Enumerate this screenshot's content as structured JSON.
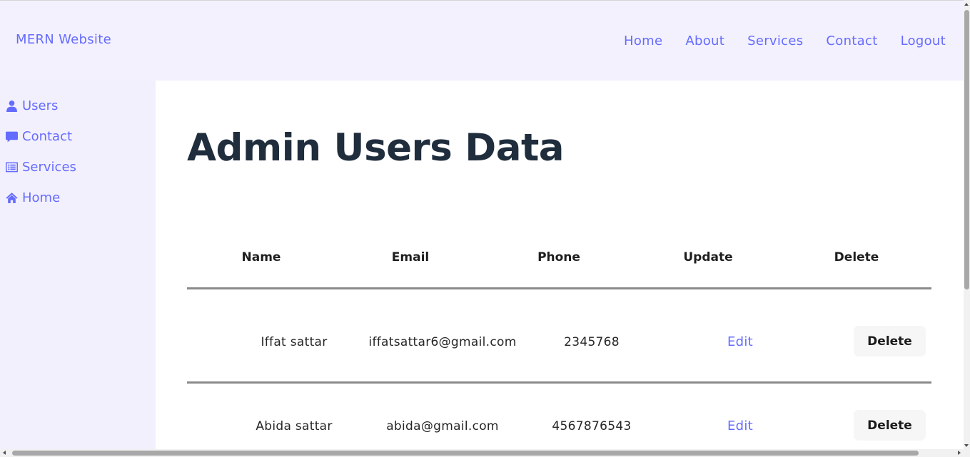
{
  "header": {
    "brand": "MERN Website",
    "nav": [
      "Home",
      "About",
      "Services",
      "Contact",
      "Logout"
    ]
  },
  "sidebar": {
    "items": [
      {
        "label": "Users",
        "icon": "user-icon"
      },
      {
        "label": "Contact",
        "icon": "message-icon"
      },
      {
        "label": "Services",
        "icon": "list-icon"
      },
      {
        "label": "Home",
        "icon": "home-icon"
      }
    ]
  },
  "main": {
    "title": "Admin Users Data",
    "table": {
      "columns": [
        "Name",
        "Email",
        "Phone",
        "Update",
        "Delete"
      ],
      "rows": [
        {
          "name": "Iffat sattar",
          "email": "iffatsattar6@gmail.com",
          "phone": "2345768",
          "edit": "Edit",
          "delete": "Delete"
        },
        {
          "name": "Abida sattar",
          "email": "abida@gmail.com",
          "phone": "4567876543",
          "edit": "Edit",
          "delete": "Delete"
        }
      ]
    }
  },
  "colors": {
    "accent": "#646cff",
    "title": "#1f2d3d",
    "background": "#f3f0fd"
  }
}
